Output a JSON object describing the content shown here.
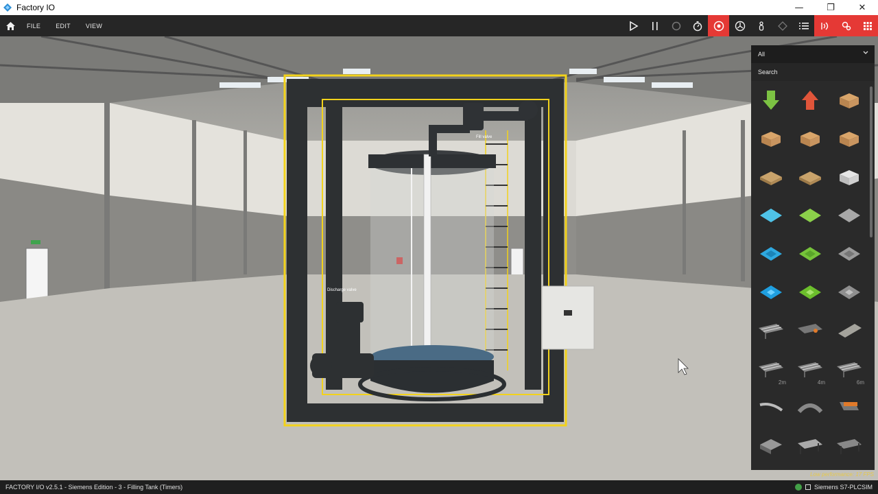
{
  "window": {
    "title": "Factory IO",
    "minimize": "—",
    "maximize": "❐",
    "close": "✕"
  },
  "menu": {
    "file": "FILE",
    "edit": "EDIT",
    "view": "VIEW"
  },
  "toolbar_icons": [
    "play-icon",
    "pause-icon",
    "reset-icon",
    "timer-icon",
    "camera-orbit-icon",
    "camera-fly-icon",
    "first-person-icon",
    "selection-icon",
    "list-icon",
    "sensors-icon",
    "tags-icon",
    "drivers-icon"
  ],
  "palette": {
    "category": "All",
    "search_label": "Search",
    "items": [
      {
        "name": "emitter",
        "icon": "green-arrow-down-icon"
      },
      {
        "name": "remover",
        "icon": "red-arrow-up-icon"
      },
      {
        "name": "small-box",
        "icon": "box-icon"
      },
      {
        "name": "medium-box",
        "icon": "box-icon"
      },
      {
        "name": "large-box",
        "icon": "box-icon"
      },
      {
        "name": "tall-box",
        "icon": "box-icon"
      },
      {
        "name": "pallet",
        "icon": "pallet-icon"
      },
      {
        "name": "pallet-2",
        "icon": "pallet-icon"
      },
      {
        "name": "stackable-box",
        "icon": "crate-icon"
      },
      {
        "name": "blue-raw-material",
        "icon": "blue-plate-icon"
      },
      {
        "name": "green-raw-material",
        "icon": "green-plate-icon"
      },
      {
        "name": "metal-raw-material",
        "icon": "metal-plate-icon"
      },
      {
        "name": "blue-product-base",
        "icon": "blue-base-icon"
      },
      {
        "name": "green-product-base",
        "icon": "green-base-icon"
      },
      {
        "name": "metal-product-base",
        "icon": "metal-base-icon"
      },
      {
        "name": "blue-lid",
        "icon": "blue-lid-icon"
      },
      {
        "name": "green-lid",
        "icon": "green-lid-icon"
      },
      {
        "name": "metal-lid",
        "icon": "metal-lid-icon"
      },
      {
        "name": "roller-conveyor-light",
        "icon": "roller-conveyor-icon"
      },
      {
        "name": "chain-transfer",
        "icon": "chain-transfer-icon"
      },
      {
        "name": "belt-conveyor-plate",
        "icon": "plate-icon"
      },
      {
        "name": "roller-conveyor-2m",
        "icon": "roller-conveyor-icon",
        "length": "2m"
      },
      {
        "name": "roller-conveyor-4m",
        "icon": "roller-conveyor-icon",
        "length": "4m"
      },
      {
        "name": "roller-conveyor-6m",
        "icon": "roller-conveyor-icon",
        "length": "6m"
      },
      {
        "name": "curved-conveyor",
        "icon": "curved-conveyor-icon"
      },
      {
        "name": "curved-roller",
        "icon": "curved-roller-icon"
      },
      {
        "name": "belt-conveyor",
        "icon": "belt-conveyor-icon"
      },
      {
        "name": "turntable",
        "icon": "turntable-icon"
      },
      {
        "name": "transfer-table",
        "icon": "transfer-table-icon"
      },
      {
        "name": "belt-transfer",
        "icon": "belt-transfer-icon"
      }
    ]
  },
  "scene": {
    "fill_valve_label": "Fill valve",
    "discharge_valve_label": "Discharge valve",
    "highlight_color": "#f2d21b"
  },
  "status": {
    "left": "FACTORY I/O v2.5.1 - Siemens Edition - 3 - Filling Tank (Timers)",
    "driver": "Siemens S7-PLCSIM",
    "performance": "Low performance: 17 FPS"
  }
}
